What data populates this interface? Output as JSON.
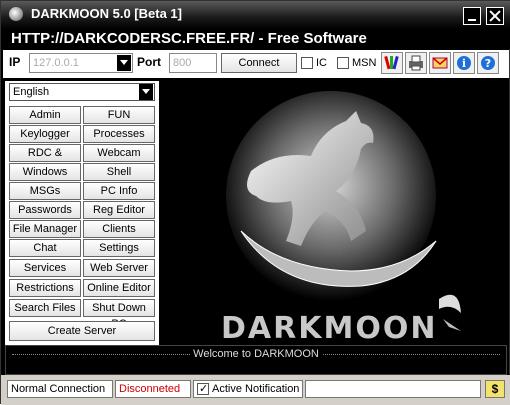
{
  "window": {
    "title": "DARKMOON 5.0 [Beta 1]"
  },
  "banner": {
    "text": "HTTP://DARKCODERSC.FREE.FR/ - Free Software"
  },
  "toolbar": {
    "ip_label": "IP",
    "ip_value": "127.0.0.1",
    "port_label": "Port",
    "port_value": "800",
    "connect_label": "Connect",
    "ic_label": "IC",
    "msn_label": "MSN"
  },
  "language": {
    "selected": "English"
  },
  "buttons": {
    "admin": "Admin",
    "fun": "FUN",
    "keylogger": "Keylogger",
    "processes": "Processes",
    "rdc": "RDC & Screen",
    "webcam": "Webcam",
    "windows": "Windows",
    "shell": "Shell",
    "msgs": "MSGs",
    "pcinfo": "PC Info",
    "passwords": "Passwords",
    "regeditor": "Reg Editor",
    "filemanager": "File Manager",
    "clients": "Clients",
    "chat": "Chat",
    "settings": "Settings",
    "services": "Services",
    "webserver": "Web Server",
    "restrictions": "Restrictions",
    "onlineeditor": "Online Editor",
    "searchfiles": "Search Files",
    "shutdown": "Shut Down PC",
    "createserver": "Create Server"
  },
  "view": {
    "brand": "DARKMOON"
  },
  "console": {
    "message": "Welcome to DARKMOON"
  },
  "status": {
    "connection": "Normal Connection",
    "state": "Disconneted",
    "notify_label": "Active Notification",
    "state_color": "#cc0000"
  }
}
